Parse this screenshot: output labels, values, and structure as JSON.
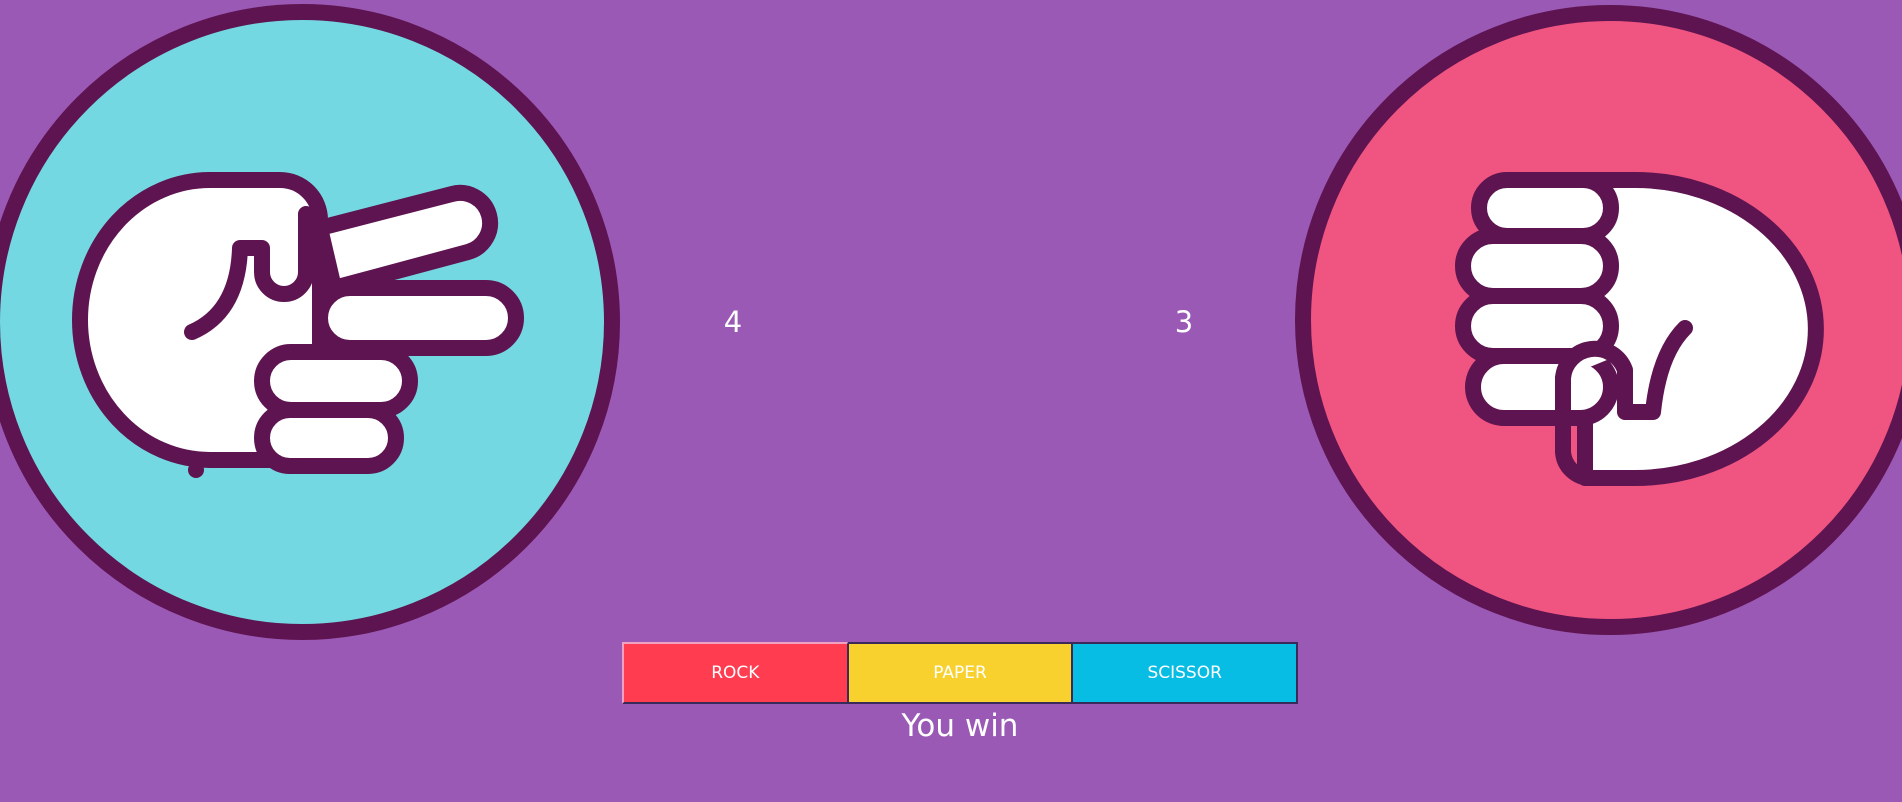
{
  "player": {
    "score": "4",
    "hand_icon": "scissors-hand-icon",
    "circle_color": "#74d8e2"
  },
  "cpu": {
    "score": "3",
    "hand_icon": "rock-fist-icon",
    "circle_color": "#ef5580"
  },
  "colors": {
    "background": "#9b59b6",
    "outline": "#5e1450",
    "rock": "#ff3c50",
    "paper": "#f8d12e",
    "scissor": "#08bde3"
  },
  "buttons": {
    "rock": "ROCK",
    "paper": "PAPER",
    "scissor": "SCISSOR"
  },
  "result_text": "You win"
}
